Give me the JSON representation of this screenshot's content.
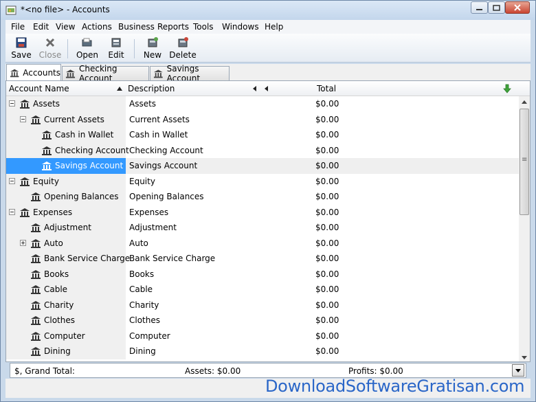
{
  "window": {
    "title": "*<no file> - Accounts"
  },
  "menu": [
    "File",
    "Edit",
    "View",
    "Actions",
    "Business",
    "Reports",
    "Tools",
    "Windows",
    "Help"
  ],
  "toolbar": {
    "save": "Save",
    "close": "Close",
    "open": "Open",
    "edit": "Edit",
    "new": "New",
    "delete": "Delete"
  },
  "tabs": [
    "Accounts",
    "Checking Account",
    "Savings Account"
  ],
  "columns": {
    "name": "Account Name",
    "description": "Description",
    "total": "Total"
  },
  "accounts": [
    {
      "name": "Assets",
      "description": "Assets",
      "total": "$0.00",
      "expander": "minus"
    },
    {
      "name": "Current Assets",
      "description": "Current Assets",
      "total": "$0.00",
      "expander": "minus"
    },
    {
      "name": "Cash in Wallet",
      "description": "Cash in Wallet",
      "total": "$0.00"
    },
    {
      "name": "Checking Account",
      "description": "Checking Account",
      "total": "$0.00"
    },
    {
      "name": "Savings Account",
      "description": "Savings Account",
      "total": "$0.00",
      "selected": true
    },
    {
      "name": "Equity",
      "description": "Equity",
      "total": "$0.00",
      "expander": "minus"
    },
    {
      "name": "Opening Balances",
      "description": "Opening Balances",
      "total": "$0.00"
    },
    {
      "name": "Expenses",
      "description": "Expenses",
      "total": "$0.00",
      "expander": "minus"
    },
    {
      "name": "Adjustment",
      "description": "Adjustment",
      "total": "$0.00"
    },
    {
      "name": "Auto",
      "description": "Auto",
      "total": "$0.00",
      "expander": "plus"
    },
    {
      "name": "Bank Service Charge",
      "description": "Bank Service Charge",
      "total": "$0.00"
    },
    {
      "name": "Books",
      "description": "Books",
      "total": "$0.00"
    },
    {
      "name": "Cable",
      "description": "Cable",
      "total": "$0.00"
    },
    {
      "name": "Charity",
      "description": "Charity",
      "total": "$0.00"
    },
    {
      "name": "Clothes",
      "description": "Clothes",
      "total": "$0.00"
    },
    {
      "name": "Computer",
      "description": "Computer",
      "total": "$0.00"
    },
    {
      "name": "Dining",
      "description": "Dining",
      "total": "$0.00"
    }
  ],
  "summary": {
    "grand_total": "$, Grand Total:",
    "assets": "Assets: $0.00",
    "profits": "Profits: $0.00"
  },
  "watermark": "DownloadSoftwareGratisan.com",
  "colors": {
    "selection": "#3399ff",
    "name_column_bg": "#f0f0f0",
    "window_frame": "#c9d9ea",
    "watermark": "#2a66c8"
  }
}
